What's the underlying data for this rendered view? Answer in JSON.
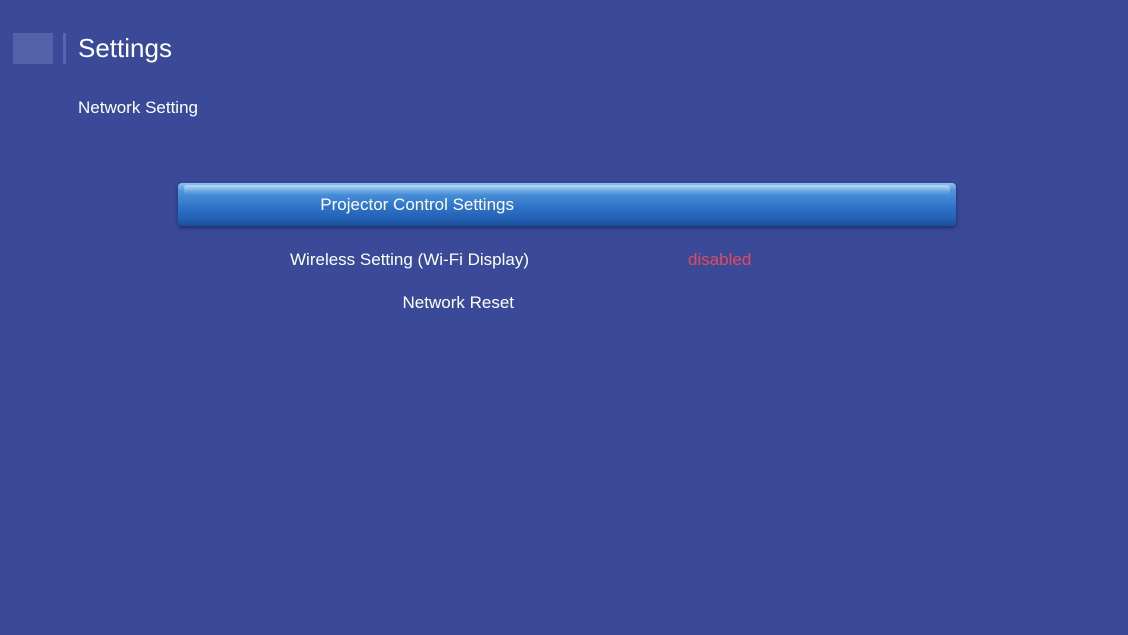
{
  "header": {
    "title": "Settings",
    "icon": "settings-app-icon"
  },
  "subtitle": "Network Setting",
  "menu": {
    "items": [
      {
        "label": "Projector Control Settings",
        "selected": true
      },
      {
        "label": "Wireless Setting (Wi-Fi Display)",
        "value": "disabled",
        "selected": false
      },
      {
        "label": "Network Reset",
        "selected": false
      }
    ]
  },
  "colors": {
    "background": "#3a4a99",
    "highlight": "#2f74c8",
    "value_text": "#e34a5a",
    "text": "#ffffff"
  }
}
